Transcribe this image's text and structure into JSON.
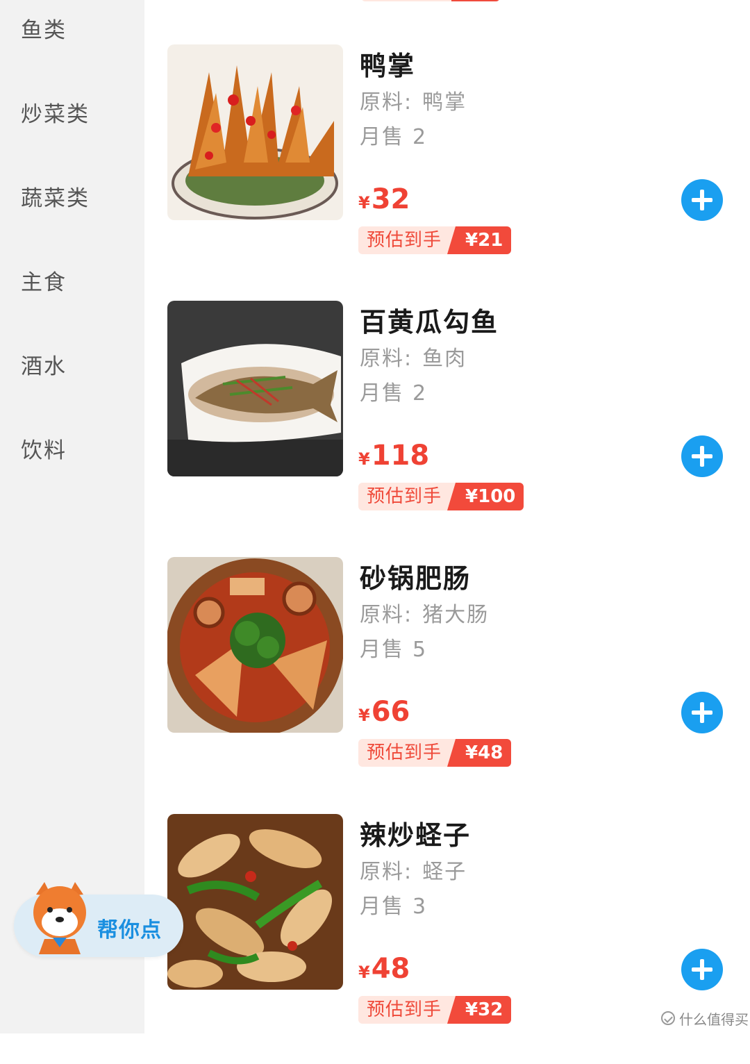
{
  "sidebar": {
    "categories": [
      {
        "label": "鱼类"
      },
      {
        "label": "炒菜类"
      },
      {
        "label": "蔬菜类"
      },
      {
        "label": "主食"
      },
      {
        "label": "酒水"
      },
      {
        "label": "饮料"
      }
    ]
  },
  "labels": {
    "ingredients_prefix": "原料:",
    "sales_prefix": "月售",
    "currency": "¥",
    "estimate_label": "预估到手"
  },
  "menu": [
    {
      "name": "鸭掌",
      "ingredient": "鸭掌",
      "monthly_sales": "2",
      "price": "32",
      "estimate": "¥21",
      "image": "duck-feet-dish"
    },
    {
      "name": "百黄瓜勾鱼",
      "ingredient": "鱼肉",
      "monthly_sales": "2",
      "price": "118",
      "estimate": "¥100",
      "image": "steamed-fish-dish"
    },
    {
      "name": "砂锅肥肠",
      "ingredient": "猪大肠",
      "monthly_sales": "5",
      "price": "66",
      "estimate": "¥48",
      "image": "claypot-intestine-dish"
    },
    {
      "name": "辣炒蛏子",
      "ingredient": "蛏子",
      "monthly_sales": "3",
      "price": "48",
      "estimate": "¥32",
      "image": "spicy-razor-clam-dish"
    }
  ],
  "helper": {
    "label": "帮你点",
    "icon": "shiba-mascot-icon"
  },
  "watermark": {
    "text": "什么值得买",
    "icon": "check-circle-icon"
  },
  "colors": {
    "price_red": "#ef4234",
    "add_button_blue": "#1a9ff0",
    "sidebar_bg": "#f2f2f2",
    "helper_text_blue": "#1a8fe0"
  }
}
